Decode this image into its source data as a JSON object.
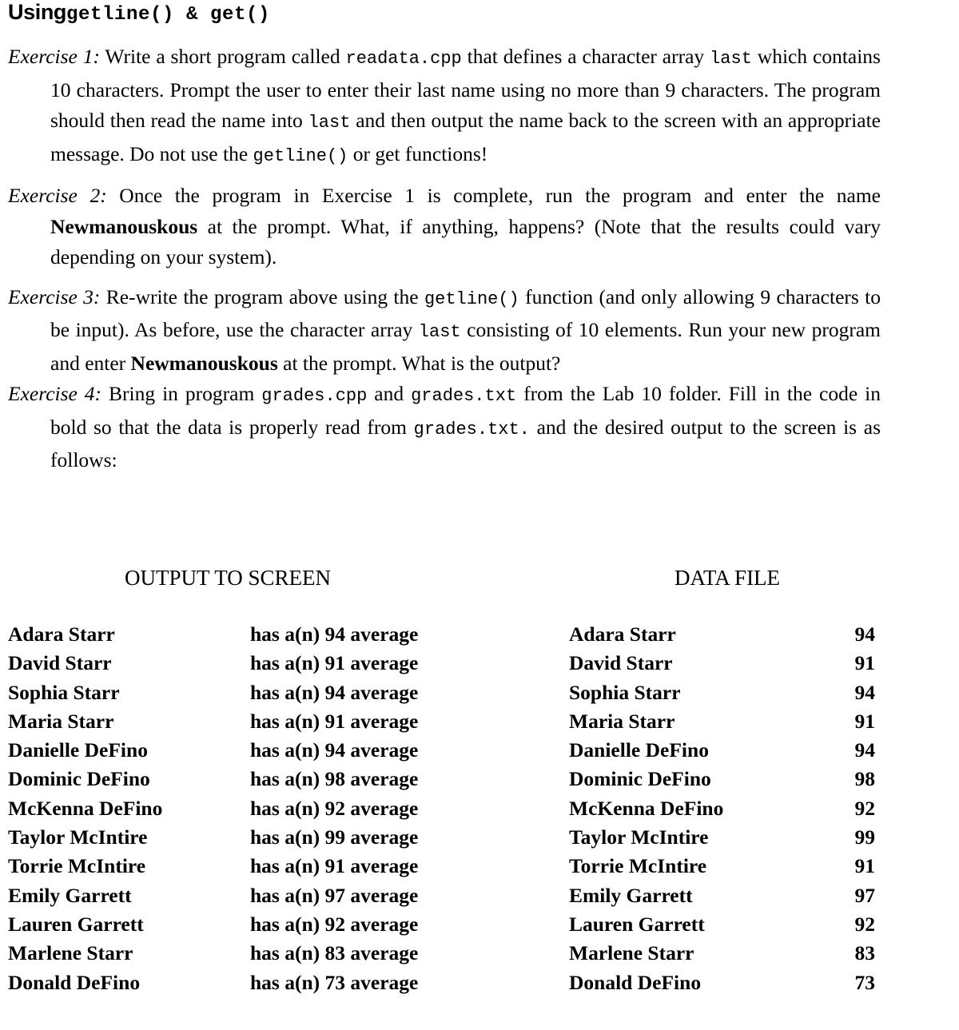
{
  "title": {
    "word": "Using",
    "code": "getline() & get()"
  },
  "exercises": [
    {
      "label": "Exercise 1:",
      "parts": [
        {
          "t": " Write a short program  called ",
          "s": "normal"
        },
        {
          "t": "readata.cpp",
          "s": "code"
        },
        {
          "t": " that defines a character array ",
          "s": "normal"
        },
        {
          "t": "last",
          "s": "code"
        },
        {
          "t": " which  contains  10 characters. Prompt the user  to enter their last name  using  no more  than 9 characters. The program  should  then  read  the name  into ",
          "s": "normal"
        },
        {
          "t": "last",
          "s": "code"
        },
        {
          "t": " and then  output  the  name  back  to the screen  with  an appropriate message. Do not use  the ",
          "s": "normal"
        },
        {
          "t": "getline()",
          "s": "code"
        },
        {
          "t": " or get functions!",
          "s": "normal"
        }
      ]
    },
    {
      "label": "Exercise 2:",
      "parts": [
        {
          "t": " Once  the  program  in Exercise  1 is complete, run  the  program  and enter  the  name  ",
          "s": "normal"
        },
        {
          "t": "Newmanouskous",
          "s": "bold"
        },
        {
          "t": " at  the  prompt.  What,  if anything, happens? (Note that the  results  could  vary  depending on your  system).",
          "s": "normal"
        }
      ]
    },
    {
      "label": "Exercise 3:",
      "parts": [
        {
          "t": " Re-write  the  program  above  using  the ",
          "s": "normal"
        },
        {
          "t": "getline()",
          "s": "code"
        },
        {
          "t": " function  (and only  allowing 9 characters to be input). As before,  use  the  character array ",
          "s": "normal"
        },
        {
          "t": "last",
          "s": "code"
        },
        {
          "t": " consisting of 10 elements. Run  your  new  program  and  enter ",
          "s": "normal"
        },
        {
          "t": "Newmanouskous",
          "s": "bold"
        },
        {
          "t": " at  the  prompt.  What  is the  output?",
          "s": "normal"
        }
      ]
    },
    {
      "label": "Exercise 4:",
      "parts": [
        {
          "t": "  Bring  in program ",
          "s": "normal"
        },
        {
          "t": "grades.cpp",
          "s": "code"
        },
        {
          "t": " and ",
          "s": "normal"
        },
        {
          "t": "grades.txt",
          "s": "code"
        },
        {
          "t": " from the Lab 10 folder.  Fill in the  code  in bold  so that  the  data  is properly read  from ",
          "s": "normal"
        },
        {
          "t": "grades.txt.",
          "s": "code"
        },
        {
          "t": " and  the desired output  to the  screen  is as follows:",
          "s": "normal"
        }
      ]
    }
  ],
  "table": {
    "headers": {
      "output": "OUTPUT TO SCREEN",
      "datafile": "DATA FILE"
    },
    "rows": [
      {
        "name": "Adara  Starr",
        "message": "has  a(n)  94  average",
        "df_name": "Adara  Starr",
        "grade": "94"
      },
      {
        "name": "David  Starr",
        "message": "has  a(n)  91  average",
        "df_name": "David  Starr",
        "grade": "91"
      },
      {
        "name": "Sophia Starr",
        "message": "has  a(n)  94  average",
        "df_name": "Sophia Starr",
        "grade": "94"
      },
      {
        "name": "Maria  Starr",
        "message": "has  a(n)  91  average",
        "df_name": "Maria  Starr",
        "grade": "91"
      },
      {
        "name": "Danielle  DeFino",
        "message": "has  a(n)  94  average",
        "df_name": "Danielle  DeFino",
        "grade": "94"
      },
      {
        "name": "Dominic  DeFino",
        "message": "has  a(n)  98  average",
        "df_name": "Dominic  DeFino",
        "grade": "98"
      },
      {
        "name": "McKenna  DeFino",
        "message": "has  a(n)  92  average",
        "df_name": "McKenna  DeFino",
        "grade": "92"
      },
      {
        "name": "Taylor  McIntire",
        "message": "has  a(n)  99  average",
        "df_name": "Taylor  McIntire",
        "grade": "99"
      },
      {
        "name": "Torrie McIntire",
        "message": "has  a(n)  91  average",
        "df_name": "Torrie McIntire",
        "grade": "91"
      },
      {
        "name": "Emily  Garrett",
        "message": "has  a(n)  97  average",
        "df_name": "Emily  Garrett",
        "grade": "97"
      },
      {
        "name": "Lauren  Garrett",
        "message": "has  a(n)  92  average",
        "df_name": "Lauren  Garrett",
        "grade": "92"
      },
      {
        "name": "Marlene Starr",
        "message": "has  a(n)  83  average",
        "df_name": "Marlene Starr",
        "grade": "83"
      },
      {
        "name": "Donald  DeFino",
        "message": "has  a(n)  73  average",
        "df_name": "Donald  DeFino",
        "grade": "73"
      }
    ]
  }
}
